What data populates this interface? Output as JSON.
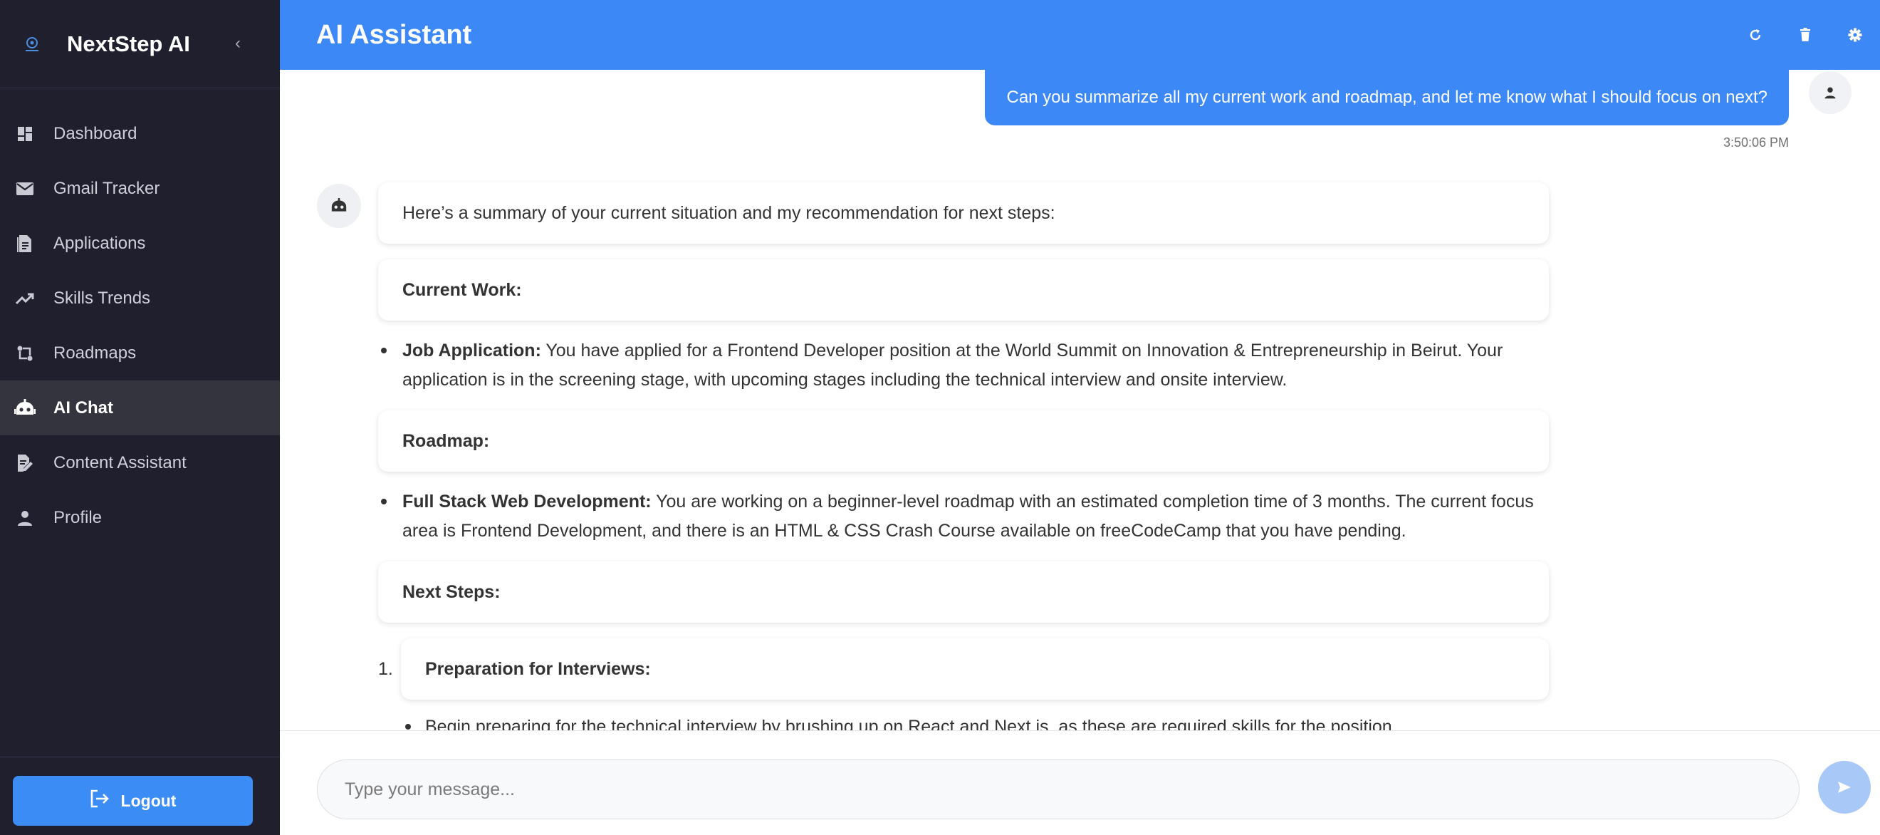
{
  "app": {
    "brand_name": "NextStep AI"
  },
  "sidebar": {
    "items": [
      {
        "label": "Dashboard",
        "icon": "dashboard-icon",
        "active": false
      },
      {
        "label": "Gmail Tracker",
        "icon": "mail-icon",
        "active": false
      },
      {
        "label": "Applications",
        "icon": "document-icon",
        "active": false
      },
      {
        "label": "Skills Trends",
        "icon": "trending-up-icon",
        "active": false
      },
      {
        "label": "Roadmaps",
        "icon": "route-icon",
        "active": false
      },
      {
        "label": "AI Chat",
        "icon": "robot-icon",
        "active": true
      },
      {
        "label": "Content Assistant",
        "icon": "edit-document-icon",
        "active": false
      },
      {
        "label": "Profile",
        "icon": "person-icon",
        "active": false
      }
    ],
    "logout_label": "Logout"
  },
  "header": {
    "title": "AI Assistant"
  },
  "chat": {
    "user_message": "Can you summarize all my current work and roadmap, and let me know what I should focus on next?",
    "user_timestamp": "3:50:06 PM",
    "bot": {
      "intro": "Here’s a summary of your current situation and my recommendation for next steps:",
      "current_work_heading": "Current Work:",
      "job_label": "Job Application:",
      "job_text": " You have applied for a Frontend Developer position at the World Summit on Innovation & Entrepreneurship in Beirut. Your application is in the screening stage, with upcoming stages including the technical interview and onsite interview.",
      "roadmap_heading": "Roadmap:",
      "roadmap_label": "Full Stack Web Development:",
      "roadmap_text": " You are working on a beginner-level roadmap with an estimated completion time of 3 months. The current focus area is Frontend Development, and there is an HTML & CSS Crash Course available on freeCodeCamp that you have pending.",
      "next_steps_heading": "Next Steps:",
      "step1_number": "1.",
      "step1_heading": "Preparation for Interviews:",
      "step1_bullet": "Begin preparing for the technical interview by brushing up on React and Next.js, as these are required skills for the position."
    }
  },
  "input": {
    "placeholder": "Type your message..."
  },
  "colors": {
    "accent": "#3d88f7",
    "sidebar_bg": "#1f1f2e",
    "send_button": "#a8c8f8"
  }
}
